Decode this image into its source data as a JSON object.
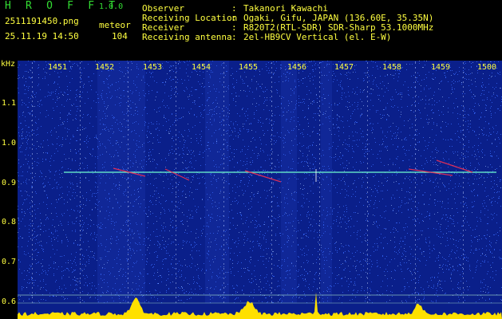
{
  "header": {
    "app_title": "H R O F F T",
    "app_version": "1.0.0",
    "file_name": "2511191450.png",
    "date_time": "25.11.19 14:50",
    "meteor_label": "meteor",
    "meteor_count": "104",
    "info": [
      {
        "label": "Observer",
        "value": "Takanori Kawachi"
      },
      {
        "label": "Receiving Location",
        "value": "Ogaki, Gifu, JAPAN (136.60E, 35.35N)"
      },
      {
        "label": "Receiver",
        "value": "R820T2(RTL-SDR) SDR-Sharp 53.1000MHz"
      },
      {
        "label": "Receiving antenna",
        "value": "2el-HB9CV Vertical (el. E-W)"
      }
    ]
  },
  "spectrogram": {
    "y_unit": "kHz",
    "y_ticks": [
      "1.1",
      "1.0",
      "0.9",
      "0.8",
      "0.7",
      "0.6"
    ],
    "x_ticks": [
      "1451",
      "1452",
      "1453",
      "1454",
      "1455",
      "1456",
      "1457",
      "1458",
      "1459",
      "1500"
    ]
  },
  "colors": {
    "text": "#ffff40",
    "title": "#33dd33",
    "background": "#0a1f8a",
    "noise": "#3a6cff",
    "carrier": "#70ffd0",
    "meteor": "#ff3050",
    "power_trace": "#ffe000"
  }
}
